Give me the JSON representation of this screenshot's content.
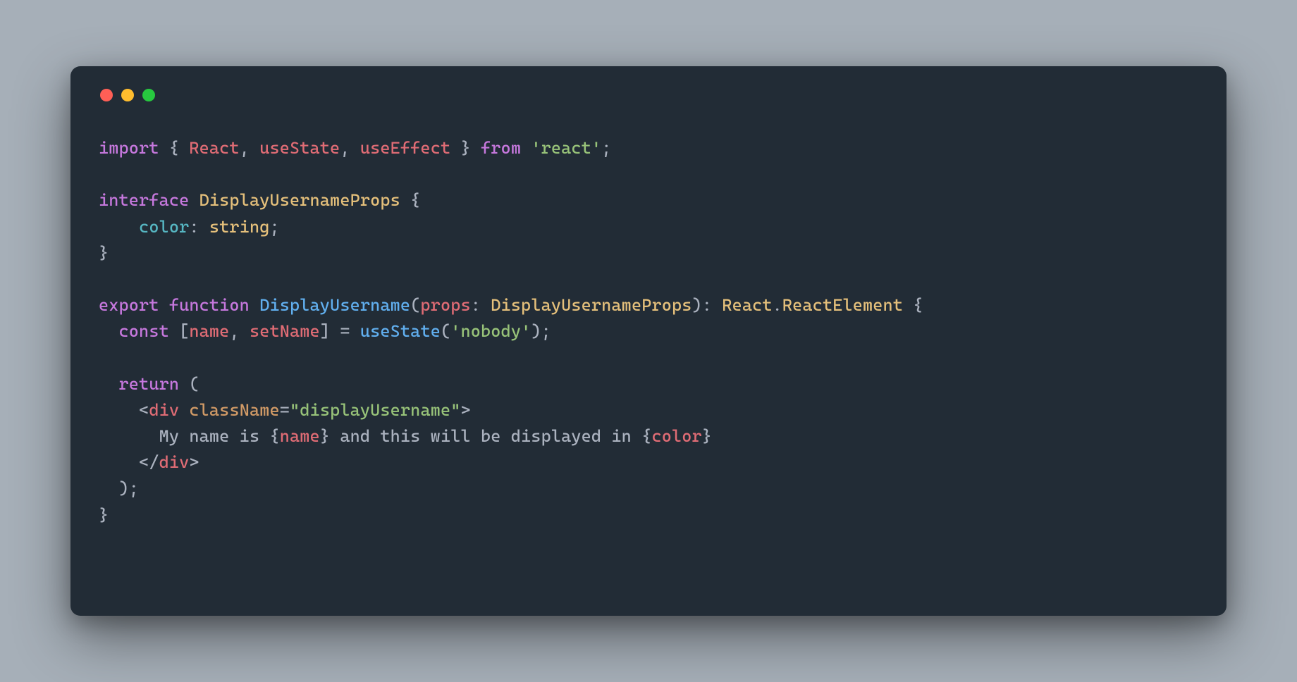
{
  "colors": {
    "bg_page": "#a6afb8",
    "bg_window": "#222c36",
    "traffic_red": "#ff5f56",
    "traffic_yellow": "#ffbd2e",
    "traffic_green": "#27c93f",
    "keyword": "#c678dd",
    "function": "#61afef",
    "type": "#e5c07b",
    "string": "#98c379",
    "property": "#56b6c2",
    "attr": "#d19a66",
    "tag": "#e06c75",
    "text": "#abb2bf"
  },
  "code": {
    "tokens": [
      [
        {
          "t": "import",
          "c": "kw"
        },
        {
          "t": " { ",
          "c": "punc"
        },
        {
          "t": "React",
          "c": "var"
        },
        {
          "t": ", ",
          "c": "punc"
        },
        {
          "t": "useState",
          "c": "var"
        },
        {
          "t": ", ",
          "c": "punc"
        },
        {
          "t": "useEffect",
          "c": "var"
        },
        {
          "t": " } ",
          "c": "punc"
        },
        {
          "t": "from",
          "c": "kw"
        },
        {
          "t": " ",
          "c": "punc"
        },
        {
          "t": "'react'",
          "c": "str"
        },
        {
          "t": ";",
          "c": "punc"
        }
      ],
      [],
      [
        {
          "t": "interface",
          "c": "kw"
        },
        {
          "t": " ",
          "c": "punc"
        },
        {
          "t": "DisplayUsernameProps",
          "c": "type"
        },
        {
          "t": " {",
          "c": "punc"
        }
      ],
      [
        {
          "t": "    ",
          "c": "punc"
        },
        {
          "t": "color",
          "c": "prop"
        },
        {
          "t": ": ",
          "c": "punc"
        },
        {
          "t": "string",
          "c": "type"
        },
        {
          "t": ";",
          "c": "punc"
        }
      ],
      [
        {
          "t": "}",
          "c": "punc"
        }
      ],
      [],
      [
        {
          "t": "export",
          "c": "kw"
        },
        {
          "t": " ",
          "c": "punc"
        },
        {
          "t": "function",
          "c": "kw"
        },
        {
          "t": " ",
          "c": "punc"
        },
        {
          "t": "DisplayUsername",
          "c": "fn"
        },
        {
          "t": "(",
          "c": "punc"
        },
        {
          "t": "props",
          "c": "var"
        },
        {
          "t": ": ",
          "c": "punc"
        },
        {
          "t": "DisplayUsernameProps",
          "c": "type"
        },
        {
          "t": "): ",
          "c": "punc"
        },
        {
          "t": "React",
          "c": "type"
        },
        {
          "t": ".",
          "c": "punc"
        },
        {
          "t": "ReactElement",
          "c": "type"
        },
        {
          "t": " {",
          "c": "punc"
        }
      ],
      [
        {
          "t": "  ",
          "c": "punc"
        },
        {
          "t": "const",
          "c": "kw"
        },
        {
          "t": " [",
          "c": "punc"
        },
        {
          "t": "name",
          "c": "var"
        },
        {
          "t": ", ",
          "c": "punc"
        },
        {
          "t": "setName",
          "c": "var"
        },
        {
          "t": "] = ",
          "c": "punc"
        },
        {
          "t": "useState",
          "c": "fn"
        },
        {
          "t": "(",
          "c": "punc"
        },
        {
          "t": "'nobody'",
          "c": "str"
        },
        {
          "t": ");",
          "c": "punc"
        }
      ],
      [],
      [
        {
          "t": "  ",
          "c": "punc"
        },
        {
          "t": "return",
          "c": "kw"
        },
        {
          "t": " (",
          "c": "punc"
        }
      ],
      [
        {
          "t": "    ",
          "c": "punc"
        },
        {
          "t": "<",
          "c": "punc"
        },
        {
          "t": "div",
          "c": "tag"
        },
        {
          "t": " ",
          "c": "punc"
        },
        {
          "t": "className",
          "c": "attr"
        },
        {
          "t": "=",
          "c": "punc"
        },
        {
          "t": "\"displayUsername\"",
          "c": "str"
        },
        {
          "t": ">",
          "c": "punc"
        }
      ],
      [
        {
          "t": "      ",
          "c": "punc"
        },
        {
          "t": "My name is ",
          "c": "txt"
        },
        {
          "t": "{",
          "c": "punc"
        },
        {
          "t": "name",
          "c": "var"
        },
        {
          "t": "}",
          "c": "punc"
        },
        {
          "t": " and this will be displayed in ",
          "c": "txt"
        },
        {
          "t": "{",
          "c": "punc"
        },
        {
          "t": "color",
          "c": "var"
        },
        {
          "t": "}",
          "c": "punc"
        }
      ],
      [
        {
          "t": "    ",
          "c": "punc"
        },
        {
          "t": "</",
          "c": "punc"
        },
        {
          "t": "div",
          "c": "tag"
        },
        {
          "t": ">",
          "c": "punc"
        }
      ],
      [
        {
          "t": "  );",
          "c": "punc"
        }
      ],
      [
        {
          "t": "}",
          "c": "punc"
        }
      ]
    ]
  }
}
